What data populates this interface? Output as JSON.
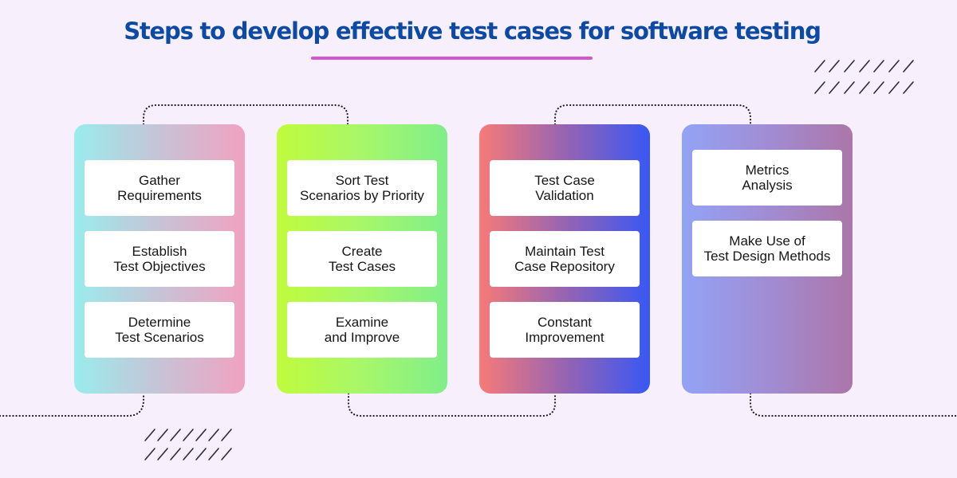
{
  "title": "Steps to develop effective test cases for software testing",
  "colors": {
    "title": "#0c4aa6",
    "underline": "#cf59cf",
    "background": "#f8effc",
    "connector": "#222222"
  },
  "columns": [
    {
      "gradient": [
        "#9aecec",
        "#f0a2c0"
      ],
      "steps": [
        {
          "label": "Gather\nRequirements"
        },
        {
          "label": "Establish\nTest Objectives"
        },
        {
          "label": "Determine\nTest Scenarios"
        }
      ]
    },
    {
      "gradient": [
        "#c0fb3c",
        "#80ee8a"
      ],
      "steps": [
        {
          "label": "Sort Test\nScenarios by Priority"
        },
        {
          "label": "Create\nTest Cases"
        },
        {
          "label": "Examine\nand Improve"
        }
      ]
    },
    {
      "gradient": [
        "#f77a78",
        "#3858f4"
      ],
      "steps": [
        {
          "label": "Test Case\nValidation"
        },
        {
          "label": "Maintain Test\nCase Repository"
        },
        {
          "label": "Constant\nImprovement"
        }
      ]
    },
    {
      "gradient": [
        "#93a3f6",
        "#ac76a8"
      ],
      "steps": [
        {
          "label": "Metrics\nAnalysis"
        },
        {
          "label": "Make Use of\nTest Design Methods"
        }
      ]
    }
  ],
  "decorations": {
    "hatch_icon": "diagonal-slash-pattern",
    "connector_icon": "dotted-path"
  }
}
